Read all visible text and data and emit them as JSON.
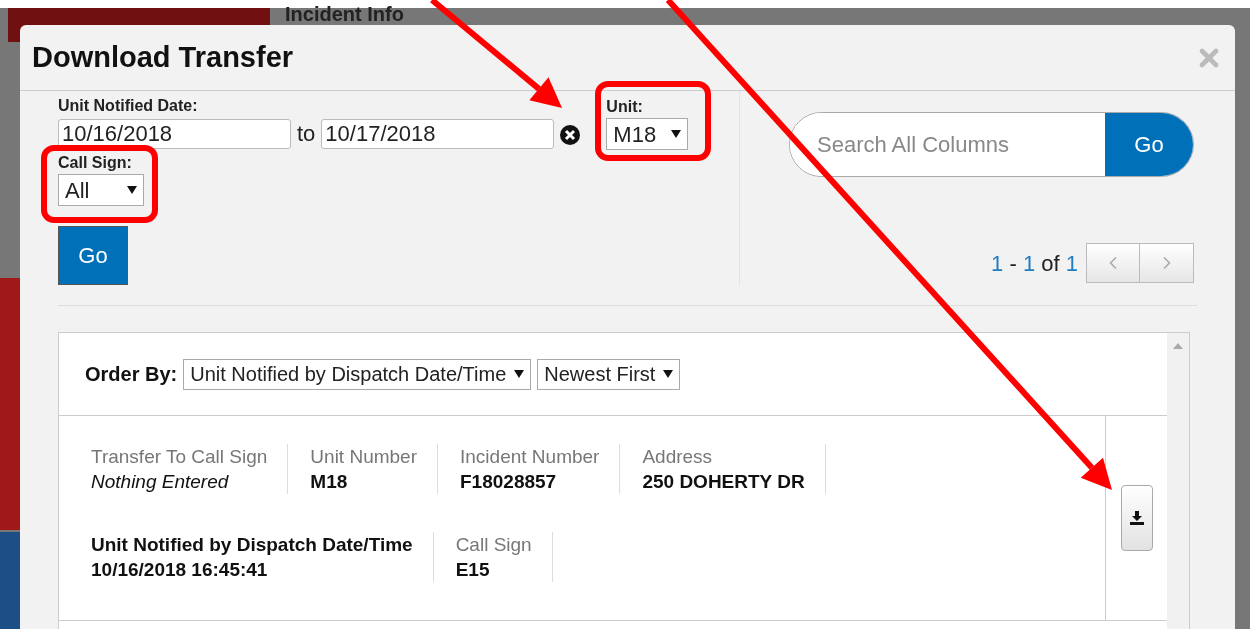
{
  "background": {
    "heading": "Incident Info"
  },
  "dialog": {
    "title": "Download Transfer"
  },
  "filters": {
    "date_label": "Unit Notified Date:",
    "date_from": "10/16/2018",
    "to_label": "to",
    "date_to": "10/17/2018",
    "unit_label": "Unit:",
    "unit_value": "M18",
    "call_sign_label": "Call Sign:",
    "call_sign_value": "All",
    "go": "Go"
  },
  "search": {
    "placeholder": "Search All Columns",
    "go": "Go"
  },
  "pagination": {
    "start": "1",
    "separator": "-",
    "end": "1",
    "of": "of",
    "total": "1"
  },
  "order": {
    "label": "Order By:",
    "field": "Unit Notified by Dispatch Date/Time",
    "direction": "Newest First"
  },
  "record": {
    "groups": [
      {
        "fields": [
          {
            "label": "Transfer To Call Sign",
            "value": "Nothing Entered",
            "kind": "missing"
          },
          {
            "label": "Unit Number",
            "value": "M18",
            "kind": "normal"
          },
          {
            "label": "Incident Number",
            "value": "F18028857",
            "kind": "normal"
          },
          {
            "label": "Address",
            "value": "250 DOHERTY DR",
            "kind": "normal"
          }
        ]
      },
      {
        "fields": [
          {
            "label": "Unit Notified by Dispatch Date/Time",
            "value": "10/16/2018 16:45:41",
            "kind": "key"
          },
          {
            "label": "Call Sign",
            "value": "E15",
            "kind": "normal"
          }
        ]
      }
    ]
  }
}
